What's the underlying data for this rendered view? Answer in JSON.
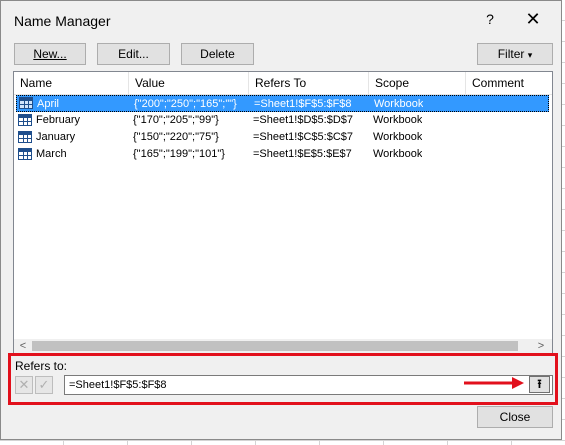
{
  "dialog": {
    "title": "Name Manager",
    "help_label": "?",
    "close_glyph": "✕"
  },
  "toolbar": {
    "new_label": "New...",
    "edit_label": "Edit...",
    "delete_label": "Delete",
    "filter_label": "Filter",
    "filter_arrow": "▾"
  },
  "columns": [
    "Name",
    "Value",
    "Refers To",
    "Scope",
    "Comment"
  ],
  "rows": [
    {
      "name": "April",
      "value": "{\"200\";\"250\";\"165\";\"\"}",
      "refers": "=Sheet1!$F$5:$F$8",
      "scope": "Workbook",
      "comment": "",
      "selected": true
    },
    {
      "name": "February",
      "value": "{\"170\";\"205\";\"99\"}",
      "refers": "=Sheet1!$D$5:$D$7",
      "scope": "Workbook",
      "comment": ""
    },
    {
      "name": "January",
      "value": "{\"150\";\"220\";\"75\"}",
      "refers": "=Sheet1!$C$5:$C$7",
      "scope": "Workbook",
      "comment": ""
    },
    {
      "name": "March",
      "value": "{\"165\";\"199\";\"101\"}",
      "refers": "=Sheet1!$E$5:$E$7",
      "scope": "Workbook",
      "comment": ""
    }
  ],
  "scroll": {
    "left": "<",
    "right": ">"
  },
  "refers_to": {
    "label": "Refers to:",
    "value": "=Sheet1!$F$5:$F$8",
    "cancel_glyph": "✕",
    "confirm_glyph": "✓",
    "collapse_glyph": "⭱"
  },
  "footer": {
    "close_label": "Close"
  },
  "colors": {
    "highlight": "#e2101c",
    "selection": "#3399ff"
  }
}
